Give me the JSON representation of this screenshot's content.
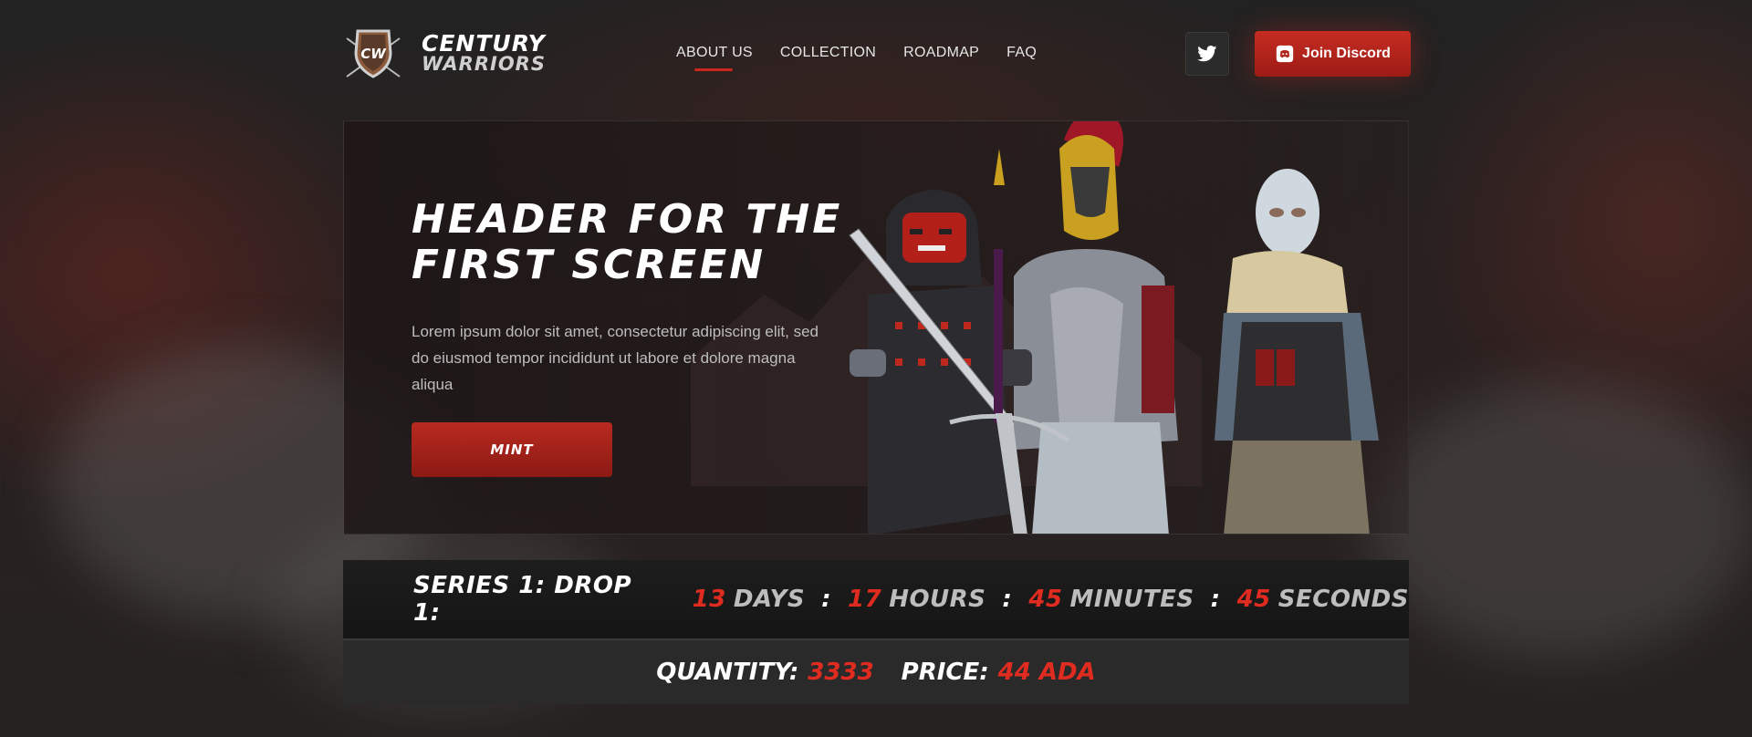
{
  "brand": {
    "logo_monogram": "CW",
    "name_line1": "CENTURY",
    "name_line2": "WARRIORS"
  },
  "nav": {
    "items": [
      {
        "label": "ABOUT US",
        "active": true
      },
      {
        "label": "COLLECTION",
        "active": false
      },
      {
        "label": "ROADMAP",
        "active": false
      },
      {
        "label": "FAQ",
        "active": false
      }
    ]
  },
  "social": {
    "twitter_icon": "twitter-icon",
    "discord_icon": "discord-icon",
    "discord_label": "Join Discord"
  },
  "hero": {
    "title_line1": "HEADER FOR THE",
    "title_line2": "FIRST SCREEN",
    "description": "Lorem ipsum dolor sit amet, consectetur adipiscing elit, sed do eiusmod tempor incididunt ut labore et dolore magna aliqua",
    "cta_label": "MINT"
  },
  "countdown": {
    "label": "SERIES 1: DROP 1:",
    "days": "13",
    "days_unit": "DAYS",
    "hours": "17",
    "hours_unit": "HOURS",
    "minutes": "45",
    "minutes_unit": "MINUTES",
    "seconds": "45",
    "seconds_unit": "SECONDS",
    "separator": ":"
  },
  "stats": {
    "quantity_label": "QUANTITY:",
    "quantity_value": "3333",
    "price_label": "PRICE:",
    "price_value": "44 ADA"
  },
  "colors": {
    "accent": "#c8281e",
    "accent_text": "#e02b20",
    "background": "#232323"
  }
}
